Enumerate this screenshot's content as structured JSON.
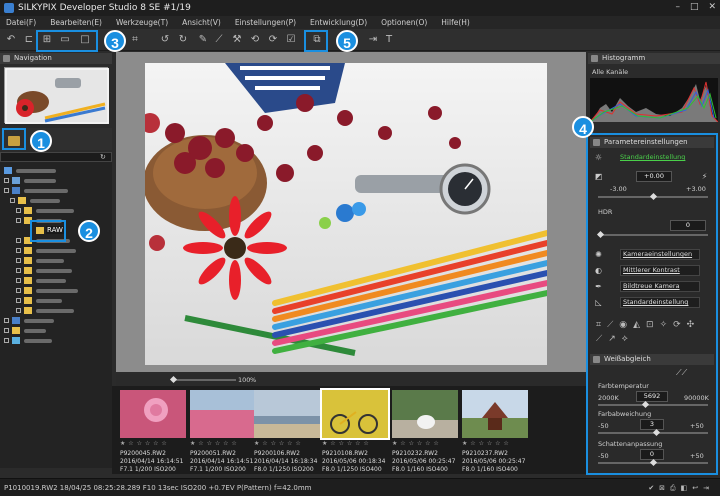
{
  "window": {
    "title": "SILKYPIX Developer Studio 8 SE   #1/19",
    "controls": [
      "–",
      "□",
      "✕"
    ]
  },
  "menu": [
    "Datei(F)",
    "Bearbeiten(E)",
    "Werkzeuge(T)",
    "Ansicht(V)",
    "Einstellungen(P)",
    "Entwicklung(D)",
    "Optionen(O)",
    "Hilfe(H)"
  ],
  "callouts": [
    "1",
    "2",
    "3",
    "4",
    "5"
  ],
  "panels": {
    "navigation": "Navigation",
    "histogram": "Histogramm",
    "histogram_channel": "Alle Kanäle",
    "parameters": "Parametereinstellungen",
    "whitebalance": "Weißabgleich"
  },
  "tree": {
    "raw_folder_label": "RAW"
  },
  "viewer": {
    "zoom_value": "100",
    "zoom_unit": "%"
  },
  "params": {
    "preset": "Standardeinstellung",
    "exposure_value": "+0.00",
    "exposure_min": "-3.00",
    "exposure_max": "+3.00",
    "hdr_label": "HDR",
    "hdr_value": "0",
    "camera_setting": "Kameraeinstellungen",
    "contrast": "Mittlerer Kontrast",
    "color_mode": "Bildtreue Kamera",
    "sharpness": "Standardeinstellung"
  },
  "whitebalance": {
    "temp_label": "Farbtemperatur",
    "temp_min": "2000K",
    "temp_value": "5692",
    "temp_max": "90000K",
    "dev_label": "Farbabweichung",
    "dev_min": "-50",
    "dev_value": "3",
    "dev_max": "+50",
    "shade_label": "Schattenanpassung",
    "shade_min": "-50",
    "shade_value": "0",
    "shade_max": "+50"
  },
  "thumbnails": [
    {
      "file": "P9200045.RW2",
      "date": "2016/04/14 16:14:51",
      "exif": "F7.1 1/200 ISO200",
      "color": "#c9567a"
    },
    {
      "file": "P9200051.RW2",
      "date": "2016/04/14 16:14:51",
      "exif": "F7.1 1/200 ISO200",
      "color": "#d86a8e"
    },
    {
      "file": "P9200106.RW2",
      "date": "2016/04/14 16:18:34",
      "exif": "F8.0 1/1250 ISO200",
      "color": "#7c92a8"
    },
    {
      "file": "P9210108.RW2",
      "date": "2016/05/06 00:18:34",
      "exif": "F8.0 1/1250 ISO400",
      "color": "#d9c23a"
    },
    {
      "file": "P9210232.RW2",
      "date": "2016/05/06 00:25:47",
      "exif": "F8.0 1/160 ISO400",
      "color": "#5a7a4a"
    },
    {
      "file": "P9210237.RW2",
      "date": "2016/05/06 00:25:47",
      "exif": "F8.0 1/160 ISO400",
      "color": "#6e8c4f"
    }
  ],
  "status": {
    "text": "P1010019.RW2 18/04/25 08:25:28.289 F10 13sec ISO200 +0.7EV P(Pattern) f=42.0mm"
  }
}
